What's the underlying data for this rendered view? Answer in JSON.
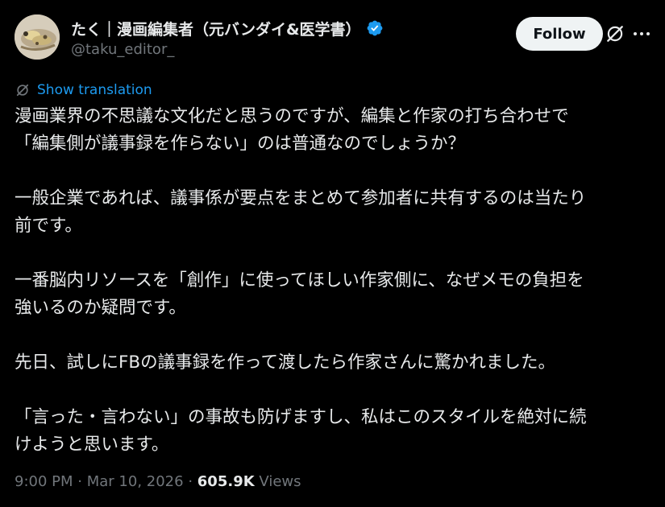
{
  "author": {
    "display_name": "たく｜漫画編集者（元バンダイ&医学書）",
    "handle": "@taku_editor_",
    "verified": true
  },
  "actions": {
    "follow_label": "Follow"
  },
  "translation": {
    "label": "Show translation"
  },
  "tweet": {
    "lines": [
      "漫画業界の不思議な文化だと思うのですが、編集と作家の打ち合わせで",
      "「編集側が議事録を作らない」のは普通なのでしょうか？",
      "",
      "一般企業であれば、議事係が要点をまとめて参加者に共有するのは当たり",
      "前です。",
      "",
      "一番脳内リソースを「創作」に使ってほしい作家側に、なぜメモの負担を",
      "強いるのか疑問です。",
      "",
      "先日、試しにFBの議事録を作って渡したら作家さんに驚かれました。",
      "",
      "「言った・言わない」の事故も防げますし、私はこのスタイルを絶対に続",
      "けようと思います。"
    ]
  },
  "meta": {
    "time": "9:00 PM",
    "separator": "·",
    "date": "Mar 10, 2026",
    "views_count": "605.9K",
    "views_label": "Views"
  },
  "colors": {
    "background": "#000000",
    "text": "#e7e9ea",
    "secondary": "#71767b",
    "accent": "#1d9bf0",
    "follow_bg": "#eff3f4"
  },
  "icons": {
    "verified": "verified-badge-icon",
    "grok": "grok-icon",
    "more": "more-options-icon",
    "translate": "translate-icon"
  }
}
